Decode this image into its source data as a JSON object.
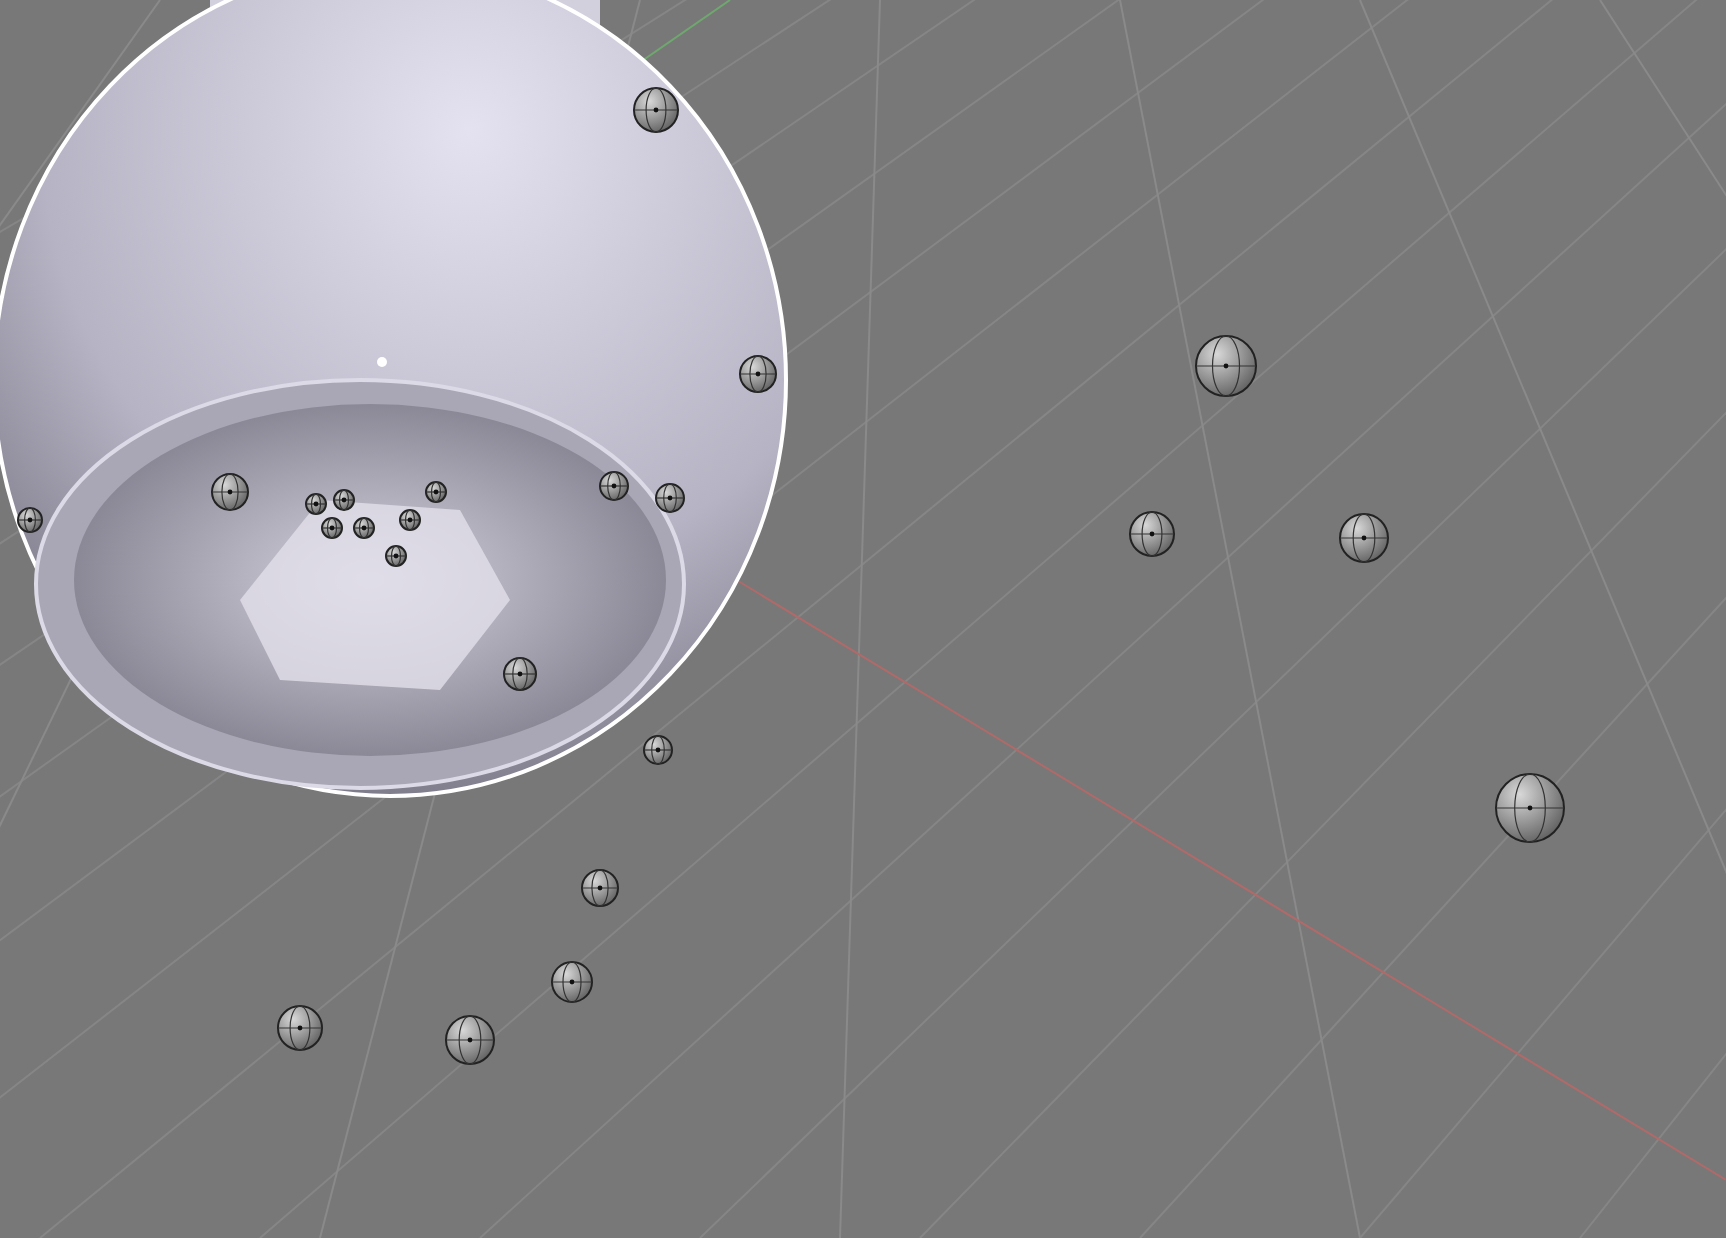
{
  "viewport": {
    "teapot": {
      "selected": true
    }
  }
}
